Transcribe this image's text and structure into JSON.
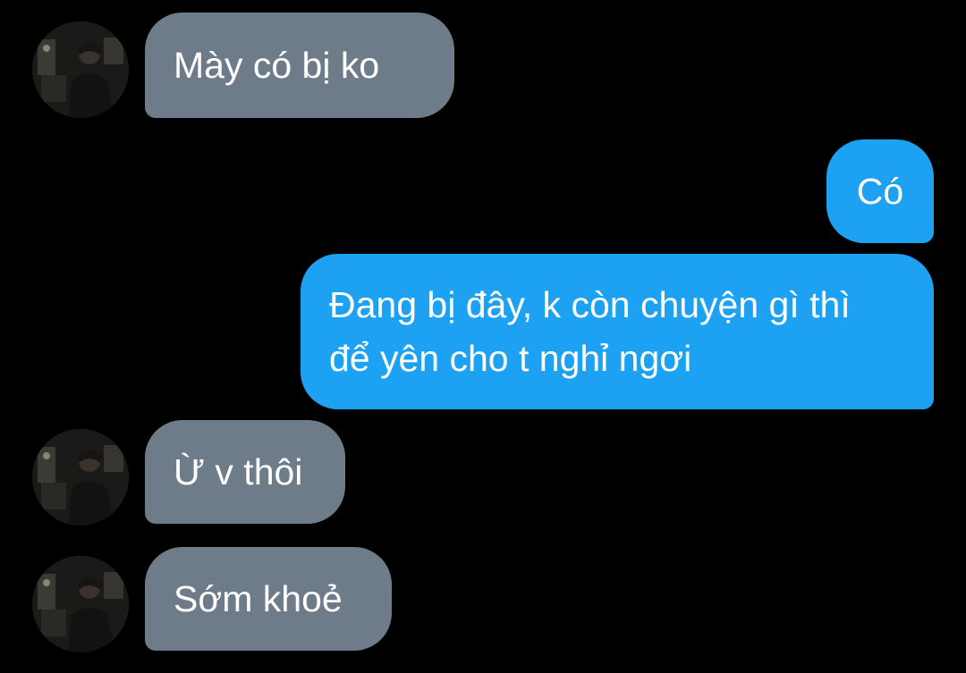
{
  "conversation": {
    "messages": [
      {
        "direction": "incoming",
        "text": "Mày có bị ko"
      },
      {
        "direction": "outgoing",
        "text": "Có"
      },
      {
        "direction": "outgoing",
        "text": "Đang bị đây, k còn chuyện gì thì để yên cho t nghỉ ngơi"
      },
      {
        "direction": "incoming",
        "text": "Ừ v thôi"
      },
      {
        "direction": "incoming",
        "text": "Sớm khoẻ"
      }
    ]
  },
  "colors": {
    "background": "#000000",
    "incoming_bubble": "#6e7b88",
    "outgoing_bubble": "#1da1f2",
    "text": "#ffffff"
  },
  "icons": {
    "avatar": "contact-avatar-photo"
  }
}
